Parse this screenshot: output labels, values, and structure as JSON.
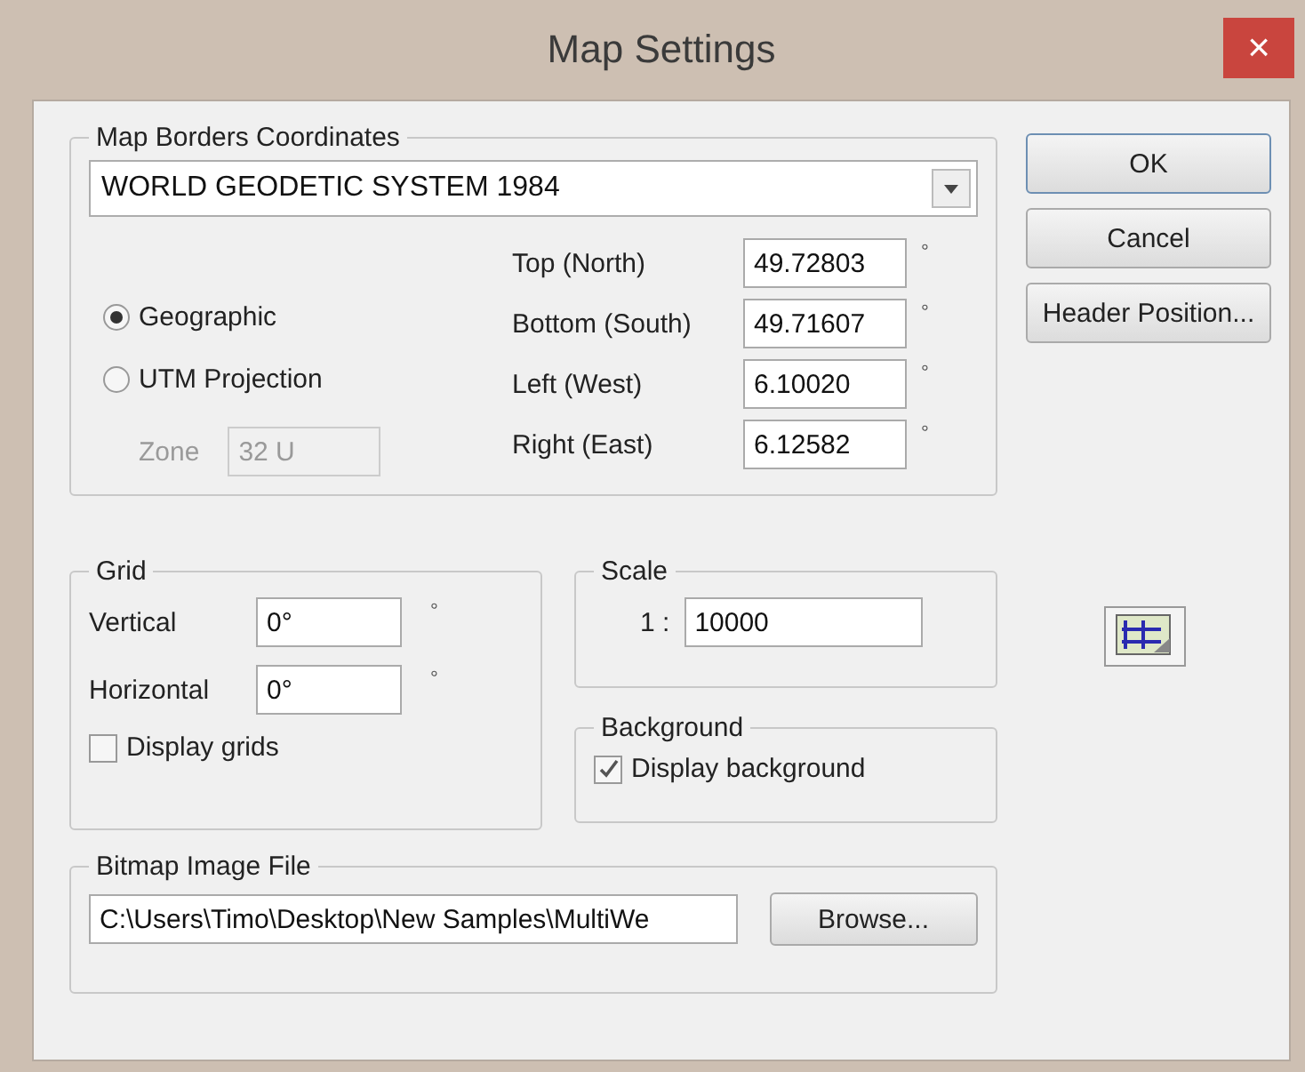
{
  "window": {
    "title": "Map Settings",
    "close": "×"
  },
  "map_borders": {
    "legend": "Map Borders Coordinates",
    "datum": "WORLD GEODETIC SYSTEM 1984",
    "projections": [
      {
        "label": "Geographic",
        "selected": true
      },
      {
        "label": "UTM Projection",
        "selected": false
      }
    ],
    "zone": {
      "label": "Zone",
      "value": "32 U",
      "disabled": true
    },
    "bounds": [
      {
        "label": "Top (North)",
        "value": "49.72803",
        "unit": "°"
      },
      {
        "label": "Bottom (South)",
        "value": "49.71607",
        "unit": "°"
      },
      {
        "label": "Left (West)",
        "value": "6.10020",
        "unit": "°"
      },
      {
        "label": "Right (East)",
        "value": "6.12582",
        "unit": "°"
      }
    ]
  },
  "grid": {
    "legend": "Grid",
    "fields": [
      {
        "label": "Vertical",
        "value": "0°",
        "unit": "°"
      },
      {
        "label": "Horizontal",
        "value": "0°",
        "unit": "°"
      }
    ],
    "display": {
      "label": "Display grids",
      "checked": false
    }
  },
  "scale": {
    "legend": "Scale",
    "prefix": "1 :",
    "value": "10000"
  },
  "background": {
    "legend": "Background",
    "display": {
      "label": "Display background",
      "checked": true
    }
  },
  "bitmap": {
    "legend": "Bitmap Image File",
    "path": "C:\\Users\\Timo\\Desktop\\New Samples\\MultiWe",
    "browse": "Browse..."
  },
  "buttons": [
    {
      "label": "OK",
      "default": true
    },
    {
      "label": "Cancel",
      "default": false
    },
    {
      "label": "Header Position...",
      "default": false
    }
  ]
}
